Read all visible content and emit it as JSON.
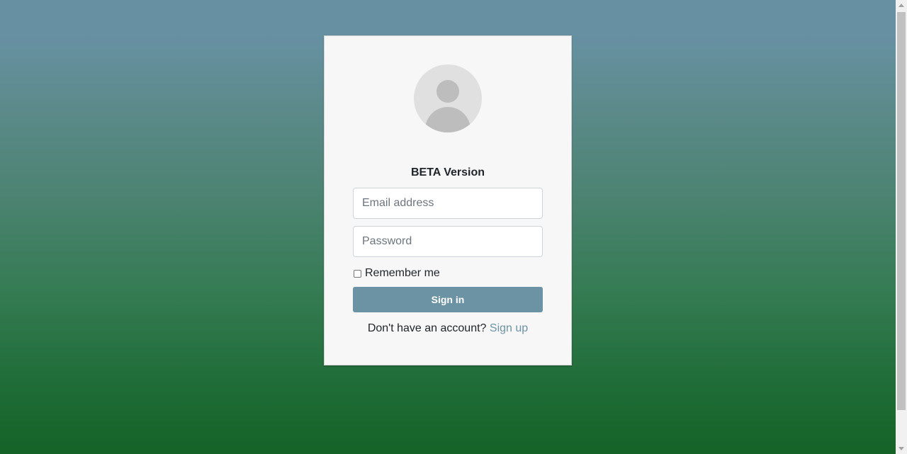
{
  "login": {
    "title": "BETA Version",
    "email": {
      "placeholder": "Email address",
      "value": ""
    },
    "password": {
      "placeholder": "Password",
      "value": ""
    },
    "remember_label": "Remember me",
    "remember_checked": false,
    "signin_label": "Sign in",
    "signup_prompt": "Don't have an account?",
    "signup_link": "Sign up"
  },
  "colors": {
    "accent": "#6c93a3",
    "gradient_top": "#6791a3",
    "gradient_bottom": "#156327",
    "card_background": "#f7f7f7"
  },
  "icons": {
    "avatar": "user-avatar-icon"
  }
}
